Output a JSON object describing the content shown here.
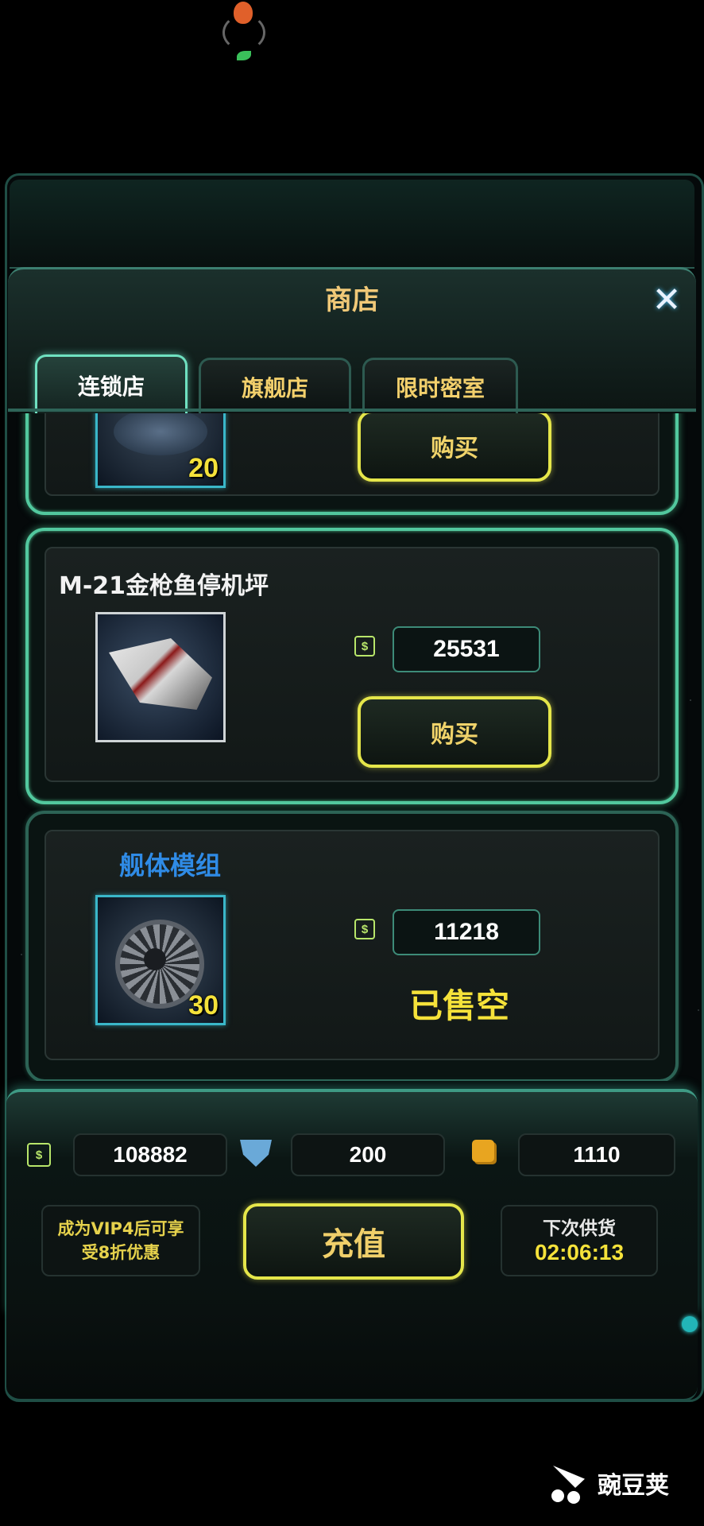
{
  "shop": {
    "title": "商店",
    "close_label": "✕",
    "tabs": [
      {
        "label": "连锁店",
        "active": true
      },
      {
        "label": "旗舰店",
        "active": false
      },
      {
        "label": "限时密室",
        "active": false
      }
    ]
  },
  "items": [
    {
      "quantity": "20",
      "buy_label": "购买"
    },
    {
      "name": "M-21金枪鱼停机坪",
      "price": "25531",
      "buy_label": "购买"
    },
    {
      "name": "舰体模组",
      "price": "11218",
      "quantity": "30",
      "status": "已售空"
    }
  ],
  "resources": {
    "credits": "108882",
    "shield_points": "200",
    "gold": "1110"
  },
  "footer": {
    "vip_text_line1": "成为VIP4后可享",
    "vip_text_line2": "受8折优惠",
    "recharge_label": "充值",
    "restock_label": "下次供货",
    "restock_timer": "02:06:13"
  },
  "watermark": {
    "text": "豌豆荚"
  },
  "colors": {
    "accent_green": "#52c89e",
    "button_yellow": "#e5e64a",
    "price_text": "#ffffff",
    "module_name_blue": "#2f8be6",
    "soldout_yellow": "#f5e23a"
  }
}
